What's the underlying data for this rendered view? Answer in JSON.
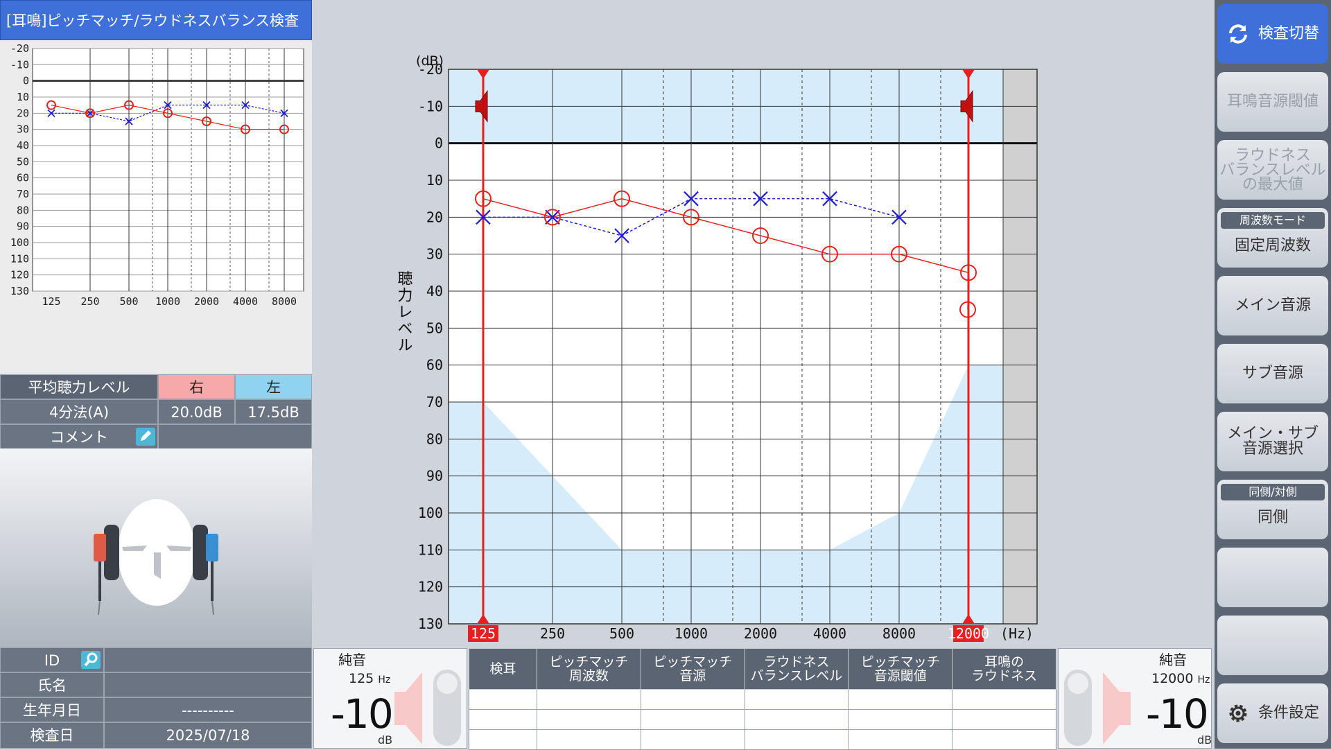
{
  "app_title": "[耳鳴]ピッチマッチ/ラウドネスバランス検査",
  "mini_chart": {
    "y_ticks": [
      "-20",
      "-10",
      "0",
      "10",
      "20",
      "30",
      "40",
      "50",
      "60",
      "70",
      "80",
      "90",
      "100",
      "110",
      "120",
      "130"
    ],
    "x_ticks": [
      "125",
      "250",
      "500",
      "1000",
      "2000",
      "4000",
      "8000"
    ],
    "right": [
      15,
      20,
      15,
      20,
      25,
      30,
      30
    ],
    "left": [
      20,
      20,
      25,
      15,
      15,
      15,
      20
    ]
  },
  "average": {
    "header_label": "平均聴力レベル",
    "right_label": "右",
    "left_label": "左",
    "method": "4分法(A)",
    "right_value": "20.0dB",
    "left_value": "17.5dB",
    "comment_label": "コメント"
  },
  "patient": {
    "id_label": "ID",
    "name_label": "氏名",
    "dob_label": "生年月日",
    "dob_value": "----------",
    "exam_date_label": "検査日",
    "exam_date_value": "2025/07/18"
  },
  "chart_data": {
    "type": "line",
    "ylabel": "聴力レベル",
    "y_unit": "(dB)",
    "x_unit": "(Hz)",
    "y_ticks": [
      "-20",
      "-10",
      "0",
      "10",
      "20",
      "30",
      "40",
      "50",
      "60",
      "70",
      "80",
      "90",
      "100",
      "110",
      "120",
      "130"
    ],
    "x_ticks": [
      "125",
      "250",
      "500",
      "1000",
      "2000",
      "4000",
      "8000",
      "12000"
    ],
    "ylim": [
      -20,
      130
    ],
    "series": [
      {
        "x": [
          125,
          250,
          500,
          1000,
          2000,
          4000,
          8000,
          12000,
          16000
        ],
        "y": [
          15,
          20,
          15,
          20,
          25,
          30,
          30,
          35,
          45
        ],
        "color": "#e81f1f"
      },
      {
        "x": [
          125,
          250,
          500,
          1000,
          2000,
          4000,
          8000
        ],
        "y": [
          20,
          20,
          25,
          15,
          15,
          15,
          20
        ],
        "color": "#1f1fd0"
      }
    ],
    "markers": [
      {
        "x_label": "125",
        "level": -10
      },
      {
        "x_label": "12000",
        "level": -10
      }
    ]
  },
  "left_sound": {
    "title": "純音",
    "freq": "125",
    "freq_unit": "Hz",
    "level": "-10",
    "unit": "dB"
  },
  "right_sound": {
    "title": "純音",
    "freq": "12000",
    "freq_unit": "Hz",
    "level": "-10",
    "unit": "dB"
  },
  "result_table": {
    "headers": [
      "検耳",
      "ピッチマッチ\n周波数",
      "ピッチマッチ\n音源",
      "ラウドネス\nバランスレベル",
      "ピッチマッチ\n音源閾値",
      "耳鳴の\nラウドネス"
    ]
  },
  "right_panel": {
    "switch_label": "検査切替",
    "threshold_label": "耳鳴音源閾値",
    "loudness_max_label": "ラウドネス\nバランスレベル\nの最大値",
    "freq_mode_caption": "周波数モード",
    "freq_mode_value": "固定周波数",
    "main_source_label": "メイン音源",
    "sub_source_label": "サブ音源",
    "main_sub_select_label": "メイン・サブ\n音源選択",
    "side_caption": "同側/対側",
    "side_value": "同側",
    "settings_label": "条件設定"
  }
}
